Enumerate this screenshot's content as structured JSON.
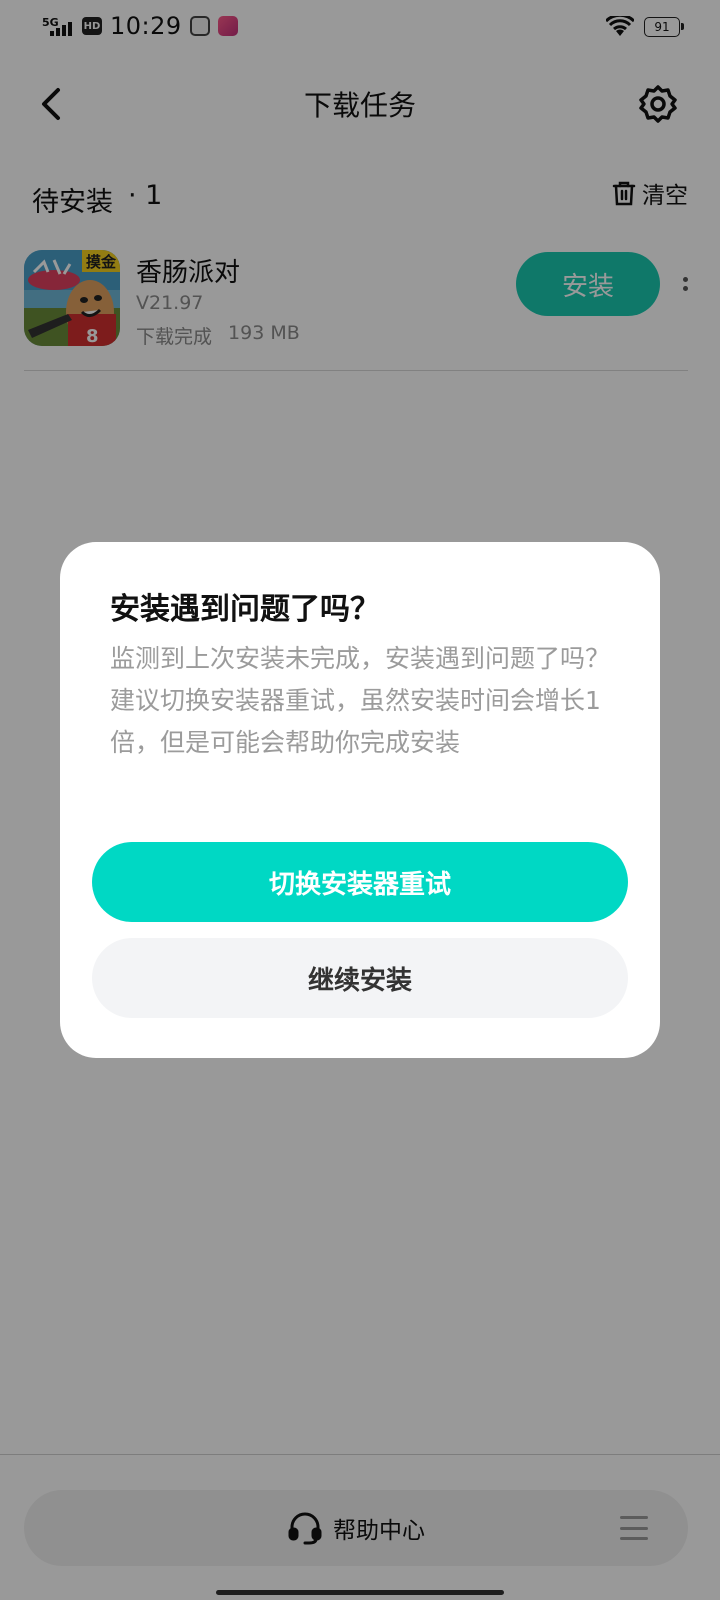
{
  "status_bar": {
    "network": "5G",
    "hd": "HD",
    "time": "10:29",
    "battery": "91",
    "icons": [
      "signal-5g-icon",
      "hd-icon",
      "notification-app-icon-1",
      "notification-app-icon-2",
      "wifi-icon",
      "battery-icon"
    ]
  },
  "header": {
    "title": "下载任务",
    "back_icon": "chevron-left-icon",
    "settings_icon": "gear-icon"
  },
  "section": {
    "title": "待安装",
    "count": "· 1",
    "clear_label": "清空",
    "clear_icon": "trash-icon"
  },
  "apps": [
    {
      "name": "香肠派对",
      "version": "V21.97",
      "status": "下载完成",
      "size": "193 MB",
      "button_label": "安装",
      "icon_badge": "摸金"
    }
  ],
  "dialog": {
    "title": "安装遇到问题了吗？",
    "body_line1": "监测到上次安装未完成，安装遇到问题了吗？",
    "body_line2": "建议切换安装器重试，虽然安装时间会增长1倍，但是可能会帮助你完成安装",
    "primary_button": "切换安装器重试",
    "secondary_button": "继续安装"
  },
  "bottom_bar": {
    "help_label": "帮助中心",
    "help_icon": "headset-icon",
    "menu_icon": "menu-icon"
  },
  "colors": {
    "accent": "#19c8b0",
    "primary_button": "#00d8c4",
    "secondary_button": "#f3f4f6",
    "overlay": "rgba(0,0,0,0.40)"
  }
}
